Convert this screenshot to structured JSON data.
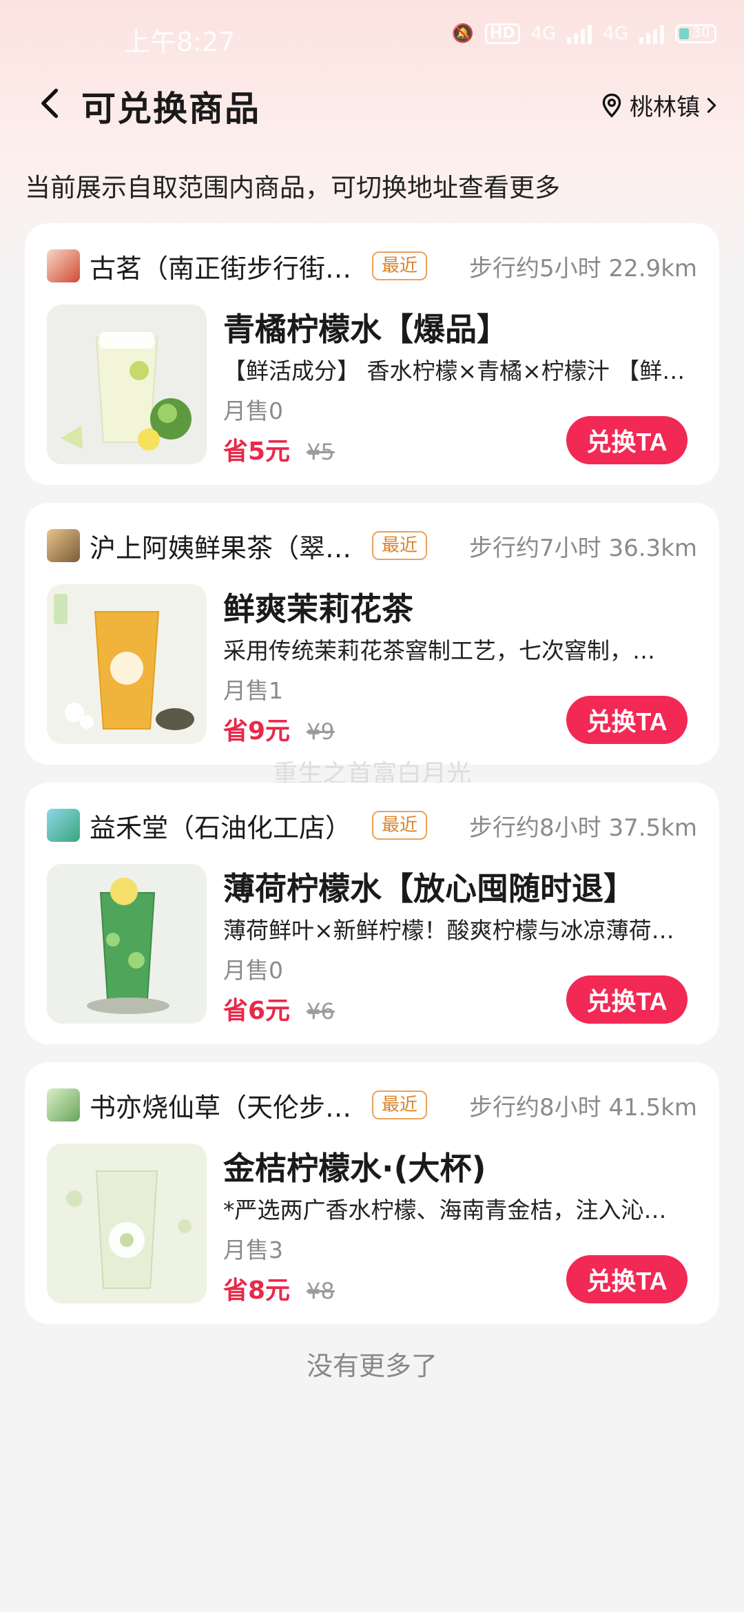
{
  "status": {
    "time": "上午8:27",
    "network": "4G",
    "battery": "30"
  },
  "header": {
    "title": "可兑换商品",
    "location": "桃林镇"
  },
  "subtitle": "当前展示自取范围内商品，可切换地址查看更多",
  "badge_label": "最近",
  "button_label": "兑换TA",
  "items": [
    {
      "store": "古茗（南正街步行街…",
      "distance": "步行约5小时 22.9km",
      "product": "青橘柠檬水【爆品】",
      "desc": "【鲜活成分】 香水柠檬×青橘×柠檬汁 【鲜…",
      "sold": "月售0",
      "save": "省5元",
      "orig": "¥5"
    },
    {
      "store": "沪上阿姨鲜果茶（翠…",
      "distance": "步行约7小时 36.3km",
      "product": "鲜爽茉莉花茶",
      "desc": "采用传统茉莉花茶窨制工艺，七次窨制，…",
      "sold": "月售1",
      "save": "省9元",
      "orig": "¥9"
    },
    {
      "store": "益禾堂（石油化工店）",
      "distance": "步行约8小时 37.5km",
      "product": "薄荷柠檬水【放心囤随时退】",
      "desc": "薄荷鲜叶×新鲜柠檬！酸爽柠檬与冰凉薄荷…",
      "sold": "月售0",
      "save": "省6元",
      "orig": "¥6"
    },
    {
      "store": "书亦烧仙草（天伦步…",
      "distance": "步行约8小时 41.5km",
      "product": "金桔柠檬水·(大杯)",
      "desc": "*严选两广香水柠檬、海南青金桔，注入沁…",
      "sold": "月售3",
      "save": "省8元",
      "orig": "¥8"
    }
  ],
  "footer": "没有更多了",
  "watermark": "重生之首富白月光",
  "colors": {
    "accent": "#f22955",
    "badge": "#e9a25b"
  }
}
